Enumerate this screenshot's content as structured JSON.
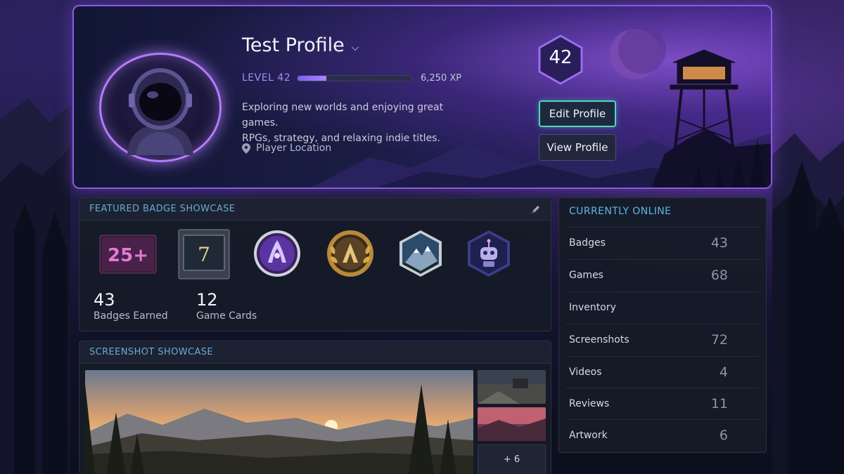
{
  "profile": {
    "name": "Test Profile",
    "level_label": "LEVEL 42",
    "level_number": "42",
    "xp": "6,250 XP",
    "xp_progress": 0.25,
    "bio_line1": "Exploring new worlds and enjoying great games.",
    "bio_line2": "RPGs, strategy, and relaxing indie titles.",
    "location": "Player Location"
  },
  "buttons": {
    "edit": "Edit Profile",
    "view": "View Profile"
  },
  "badge_showcase": {
    "title": "FEATURED BADGE SHOWCASE",
    "badges": [
      {
        "icon": "25-plus-badge-icon",
        "text": "25+"
      },
      {
        "icon": "years-of-service-7-badge-icon",
        "text": "7"
      },
      {
        "icon": "purple-emblem-badge-icon"
      },
      {
        "icon": "gold-laurel-badge-icon"
      },
      {
        "icon": "mountain-hexagon-badge-icon"
      },
      {
        "icon": "robot-hexagon-badge-icon"
      }
    ],
    "stats": [
      {
        "value": "43",
        "label": "Badges Earned"
      },
      {
        "value": "12",
        "label": "Game Cards"
      }
    ]
  },
  "screenshot_showcase": {
    "title": "SCREENSHOT SHOWCASE",
    "more": "+ 6"
  },
  "online": {
    "title": "CURRENTLY ONLINE",
    "items": [
      {
        "name": "Badges",
        "count": "43"
      },
      {
        "name": "Games",
        "count": "68"
      },
      {
        "name": "Inventory",
        "count": ""
      },
      {
        "name": "Screenshots",
        "count": "72"
      },
      {
        "name": "Videos",
        "count": "4"
      },
      {
        "name": "Reviews",
        "count": "11"
      },
      {
        "name": "Artwork",
        "count": "6"
      }
    ]
  },
  "colors": {
    "accent_purple": "#8a5ae6",
    "edit_border": "#52d6c0",
    "section_title": "#6aa9d4",
    "online_title": "#5ab8e6"
  }
}
